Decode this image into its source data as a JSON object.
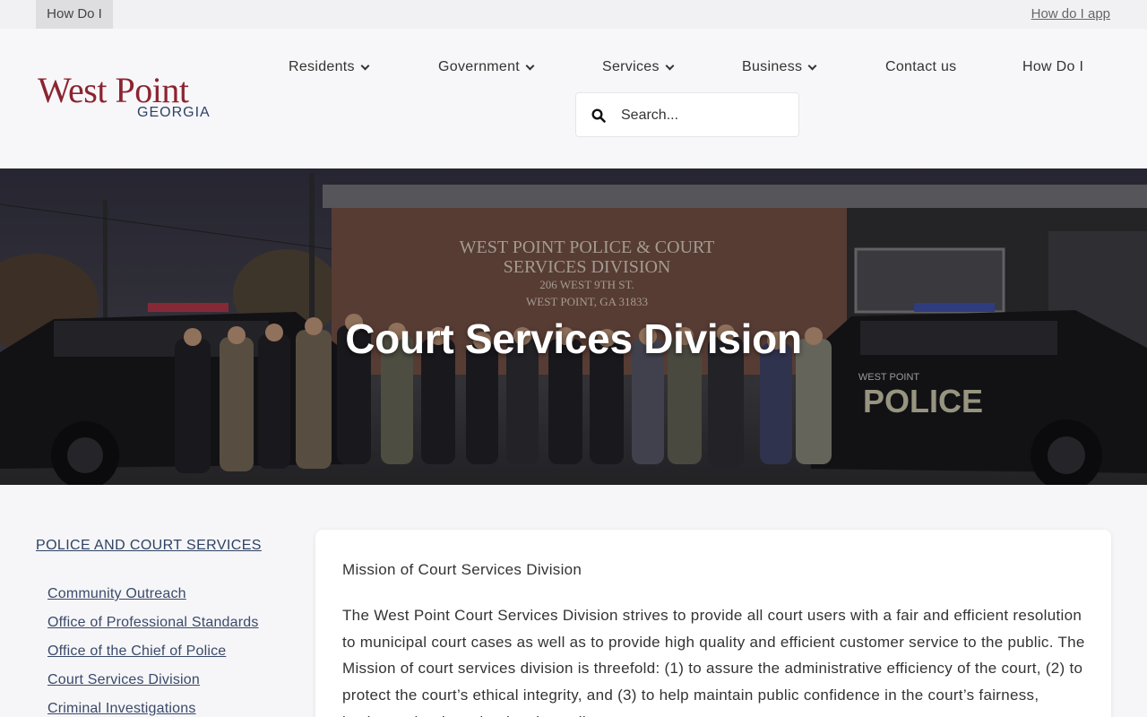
{
  "topbar": {
    "howdoi_tab": "How Do I",
    "app_link": "How do I app"
  },
  "logo": {
    "name": "West Point",
    "state": "GEORGIA"
  },
  "nav": {
    "items": [
      {
        "label": "Residents",
        "has_dropdown": true
      },
      {
        "label": "Government",
        "has_dropdown": true
      },
      {
        "label": "Services",
        "has_dropdown": true
      },
      {
        "label": "Business",
        "has_dropdown": true
      },
      {
        "label": "Contact us",
        "has_dropdown": false
      },
      {
        "label": "How Do I",
        "has_dropdown": false
      }
    ]
  },
  "search": {
    "placeholder": "Search...",
    "icon": "search-icon"
  },
  "hero": {
    "title": "Court Services Division",
    "building_sign": [
      "WEST POINT POLICE & COURT",
      "SERVICES DIVISION",
      "206 WEST 9TH ST.",
      "WEST POINT, GA 31833"
    ],
    "vehicle_text": "POLICE",
    "vehicle_brand": "WEST POINT"
  },
  "sidebar": {
    "heading": "POLICE AND COURT SERVICES",
    "items": [
      {
        "label": "Community Outreach"
      },
      {
        "label": "Office of Professional Standards"
      },
      {
        "label": "Office of the Chief of Police"
      },
      {
        "label": "Court Services Division"
      },
      {
        "label": "Criminal Investigations"
      }
    ]
  },
  "content": {
    "title": "Mission of Court Services Division",
    "body": "The West Point Court Services Division strives to provide all court users with a fair and efficient resolution to municipal court cases as well as to provide high quality and efficient customer service to the public. The Mission of court services division is threefold: (1) to assure the administrative efficiency of the court, (2) to protect the court’s ethical integrity, and (3) to help maintain public confidence in the court’s fairness, justice and reduce the time in settling cases."
  },
  "colors": {
    "brand_red": "#8c2431",
    "brand_navy": "#2e4263",
    "page_bg": "#f6f6f8"
  }
}
